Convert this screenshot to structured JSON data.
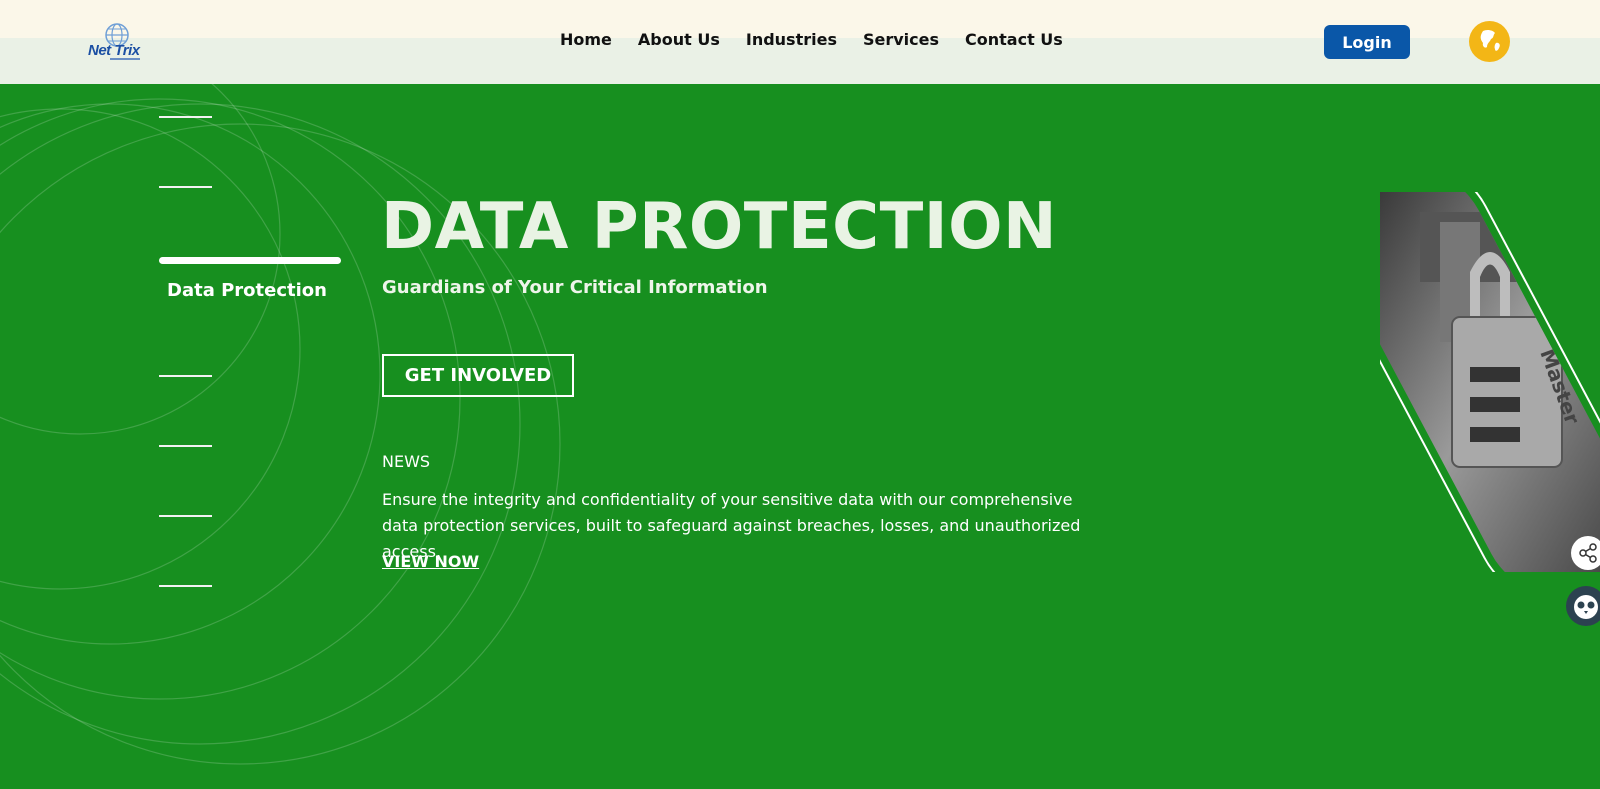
{
  "header": {
    "logo_text": "Net Trix",
    "nav": [
      "Home",
      "About Us",
      "Industries",
      "Services",
      "Contact Us"
    ],
    "login_label": "Login",
    "globe_icon": "globe-icon"
  },
  "hero": {
    "active_slide_label": "Data Protection",
    "title": "DATA PROTECTION",
    "subtitle": "Guardians of Your Critical Information",
    "cta_label": "GET INVOLVED",
    "news_label": "NEWS",
    "description": "Ensure the integrity and confidentiality of your sensitive data with our comprehensive data protection services, built to safeguard against breaches, losses, and unauthorized access.",
    "view_now_label": "VIEW NOW",
    "image_icon": "padlock-image",
    "padlock_brand": "Master"
  },
  "floating": {
    "share_icon": "share-icon",
    "assistant_icon": "owl-icon"
  },
  "colors": {
    "hero_bg": "#178f1f",
    "login_bg": "#0a57a8",
    "globe_bg": "#f3b616",
    "header_top": "#fbf7e9",
    "header_bottom": "#eaf1e6"
  }
}
